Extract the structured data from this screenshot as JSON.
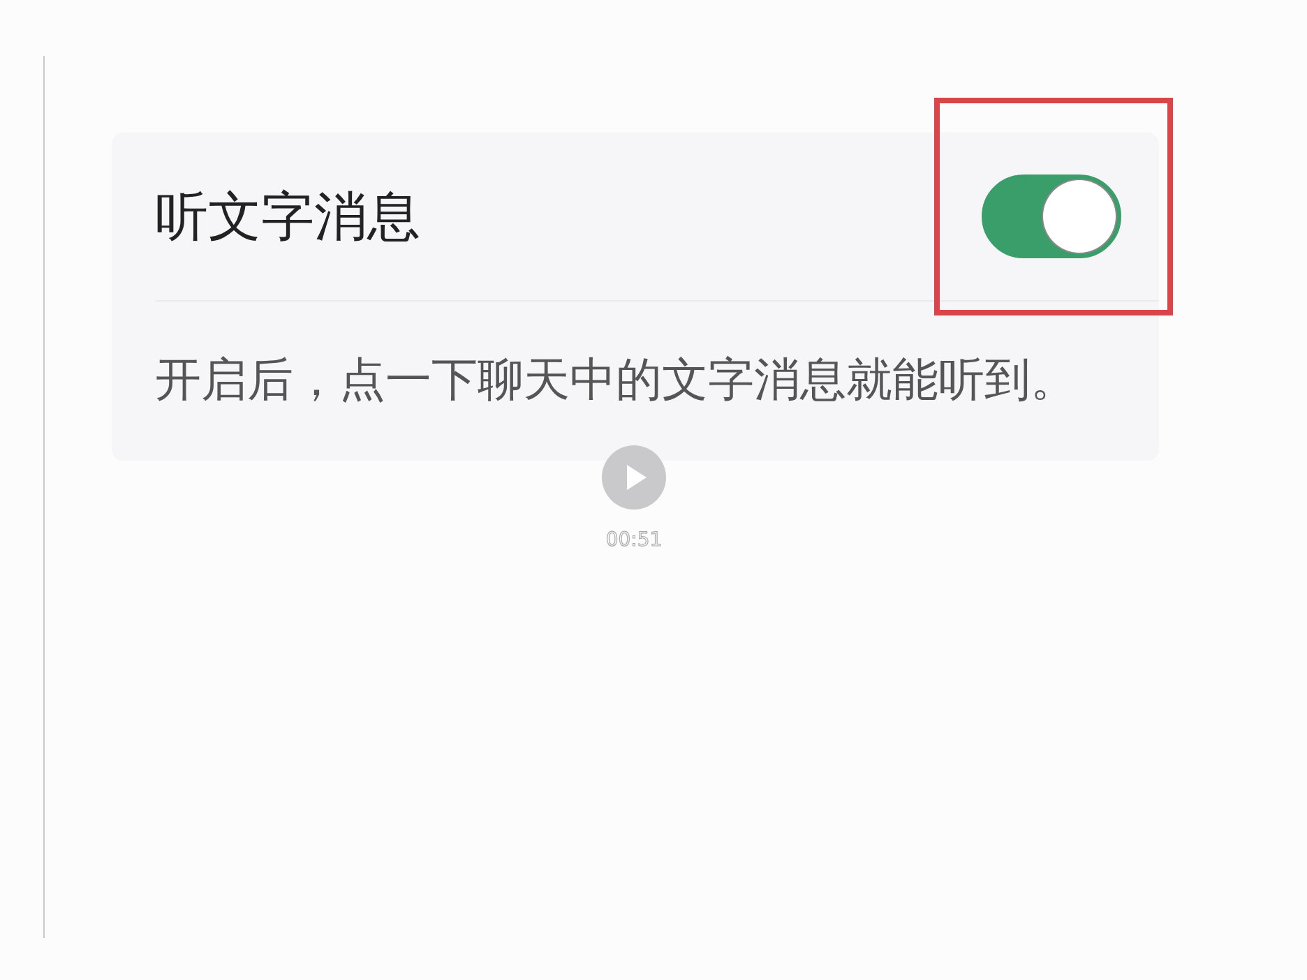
{
  "setting": {
    "title": "听文字消息",
    "on": true,
    "description": "开启后，点一下聊天中的文字消息就能听到。"
  },
  "video_overlay": {
    "duration": "00:51"
  }
}
